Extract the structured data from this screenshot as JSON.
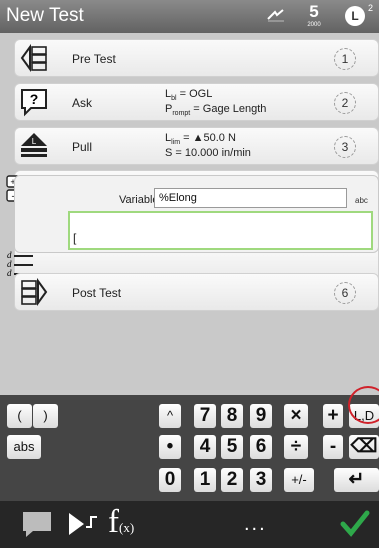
{
  "title": "New Test",
  "status": {
    "counter_big": "5",
    "counter_small": "2000",
    "clock_glyph": "L",
    "superscript": "2"
  },
  "steps": [
    {
      "icon": "pretest-icon",
      "label": "Pre Test",
      "index": "1"
    },
    {
      "icon": "question-icon",
      "label": "Ask",
      "line1": "L",
      "line1_sub": "bl",
      "line1_rest": " = OGL",
      "line2": "P",
      "line2_sub": "rompt",
      "line2_rest": " = Gage Length",
      "index": "2"
    },
    {
      "icon": "pull-icon",
      "label": "Pull",
      "line1": "L",
      "line1_sub": "lim",
      "line1_rest": " = ▲50.0 N",
      "line2": "S = 10.000 in/min",
      "index": "3"
    },
    {
      "icon": "calc-icon",
      "label": "",
      "index": ""
    },
    {
      "icon": "list-icon",
      "label": "[",
      "index": ""
    },
    {
      "icon": "posttest-icon",
      "label": "Post Test",
      "index": "6"
    }
  ],
  "variable": {
    "label": "Variable",
    "value": "%Elong",
    "suffix": "abc"
  },
  "keyboard": {
    "row1": [
      "(",
      ")",
      "^",
      "7",
      "8",
      "9",
      "×",
      "+",
      "L,D"
    ],
    "row2": [
      "abs",
      "•",
      "4",
      "5",
      "6",
      "÷",
      "-",
      "⌫"
    ],
    "row3": [
      "0",
      "1",
      "2",
      "3",
      "+/-",
      "↵"
    ]
  },
  "bottombar": {
    "fx": "f",
    "fx_sub": "(x)",
    "more": "..."
  },
  "colors": {
    "titlebar": "#707070",
    "accent_green": "#2ea84a",
    "highlight_red": "#d0212a",
    "field_border": "#9fd97e"
  }
}
